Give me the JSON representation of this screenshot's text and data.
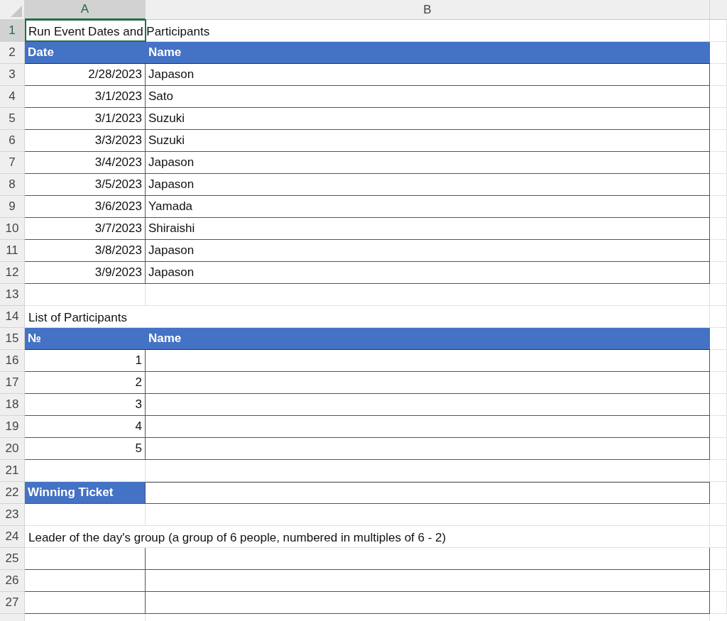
{
  "columns": [
    {
      "label": "A",
      "selected": true
    },
    {
      "label": "B",
      "selected": false
    }
  ],
  "rows": [
    {
      "number": "1",
      "selected": true,
      "kind": "title",
      "text": "Run Event Dates and Participants"
    },
    {
      "number": "2",
      "selected": false,
      "kind": "header",
      "cells": [
        "Date",
        "Name"
      ]
    },
    {
      "number": "3",
      "selected": false,
      "kind": "data",
      "cells": [
        "2/28/2023",
        "Japason"
      ]
    },
    {
      "number": "4",
      "selected": false,
      "kind": "data",
      "cells": [
        "3/1/2023",
        "Sato"
      ]
    },
    {
      "number": "5",
      "selected": false,
      "kind": "data",
      "cells": [
        "3/1/2023",
        "Suzuki"
      ]
    },
    {
      "number": "6",
      "selected": false,
      "kind": "data",
      "cells": [
        "3/3/2023",
        "Suzuki"
      ]
    },
    {
      "number": "7",
      "selected": false,
      "kind": "data",
      "cells": [
        "3/4/2023",
        "Japason"
      ]
    },
    {
      "number": "8",
      "selected": false,
      "kind": "data",
      "cells": [
        "3/5/2023",
        "Japason"
      ]
    },
    {
      "number": "9",
      "selected": false,
      "kind": "data",
      "cells": [
        "3/6/2023",
        "Yamada"
      ]
    },
    {
      "number": "10",
      "selected": false,
      "kind": "data",
      "cells": [
        "3/7/2023",
        "Shiraishi"
      ]
    },
    {
      "number": "11",
      "selected": false,
      "kind": "data",
      "cells": [
        "3/8/2023",
        "Japason"
      ]
    },
    {
      "number": "12",
      "selected": false,
      "kind": "data",
      "cells": [
        "3/9/2023",
        "Japason"
      ]
    },
    {
      "number": "13",
      "selected": false,
      "kind": "blank"
    },
    {
      "number": "14",
      "selected": false,
      "kind": "title",
      "text": "List of Participants"
    },
    {
      "number": "15",
      "selected": false,
      "kind": "header",
      "cells": [
        "№",
        "Name"
      ]
    },
    {
      "number": "16",
      "selected": false,
      "kind": "data",
      "cells": [
        "1"
      ]
    },
    {
      "number": "17",
      "selected": false,
      "kind": "data",
      "cells": [
        "2"
      ]
    },
    {
      "number": "18",
      "selected": false,
      "kind": "data",
      "cells": [
        "3"
      ]
    },
    {
      "number": "19",
      "selected": false,
      "kind": "data",
      "cells": [
        "4"
      ]
    },
    {
      "number": "20",
      "selected": false,
      "kind": "data",
      "cells": [
        "5"
      ]
    },
    {
      "number": "21",
      "selected": false,
      "kind": "blank"
    },
    {
      "number": "22",
      "selected": false,
      "kind": "label",
      "cells": [
        "Winning Ticket"
      ]
    },
    {
      "number": "23",
      "selected": false,
      "kind": "blank"
    },
    {
      "number": "24",
      "selected": false,
      "kind": "title",
      "text": "Leader of the day's group (a group of 6 people, numbered in multiples of 6 - 2)"
    },
    {
      "number": "25",
      "selected": false,
      "kind": "data",
      "cells": []
    },
    {
      "number": "26",
      "selected": false,
      "kind": "data",
      "cells": []
    },
    {
      "number": "27",
      "selected": false,
      "kind": "data",
      "cells": []
    }
  ]
}
